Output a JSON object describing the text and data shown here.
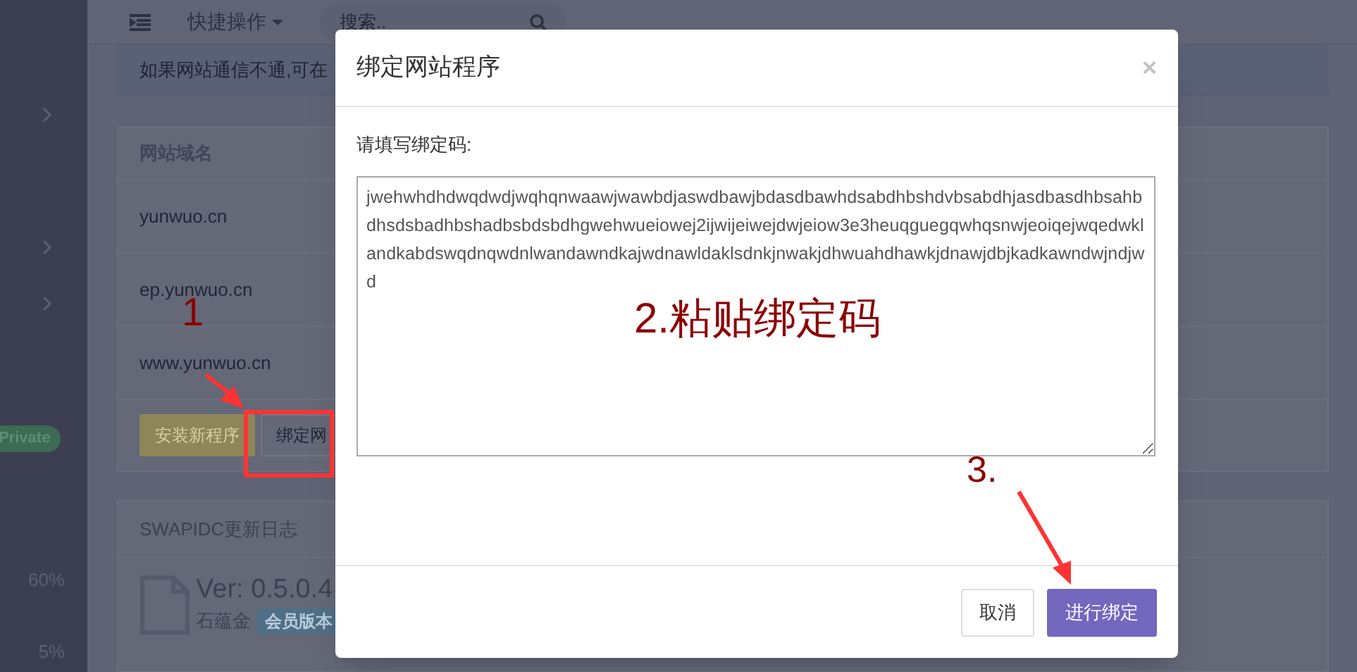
{
  "top_bar": {
    "quick_menu": "快捷操作",
    "search": {
      "placeholder": "搜索.."
    }
  },
  "sidebar": {
    "badge": "Private",
    "readings": [
      "60%",
      "5%"
    ]
  },
  "notice": "如果网站通信不通,可在",
  "domains": {
    "header": "网站域名",
    "rows": [
      "yunwuo.cn",
      "ep.yunwuo.cn",
      "www.yunwuo.cn"
    ],
    "buttons": [
      {
        "label": "安装新程序",
        "kind": "warning"
      },
      {
        "label": "绑定网",
        "kind": "default"
      }
    ]
  },
  "changelog": {
    "title": "SWAPIDC更新日志",
    "version": "Ver: 0.5.0.4",
    "author": "石蕴金",
    "badge": "会员版本"
  },
  "dialog": {
    "title": "绑定网站程序",
    "close": "×",
    "label": "请填写绑定码:",
    "value": "jwehwhdhdwqdwdjwqhqnwaawjwawbdjaswdbawjbdasdbawhdsabdhbshdvbsabdhjasdbasdhbsahbdhsdsbadhbshadbsbdsbdhgwehwueiowej2ijwijeiwejdwjeiow3e3heuqguegqwhqsnwjeoiqejwqedwklandkabdswqdnqwdnlwandawndkajwdnawldaklsdnkjnwakjdhwuahdhawkjdnawjdbjkadkawndwjndjwd",
    "buttons": [
      {
        "label": "取消",
        "kind": "default"
      },
      {
        "label": "进行绑定",
        "kind": "primary"
      }
    ]
  },
  "annotations": [
    {
      "text": "1"
    },
    {
      "text": "2.粘贴绑定码"
    },
    {
      "text": "3."
    }
  ]
}
